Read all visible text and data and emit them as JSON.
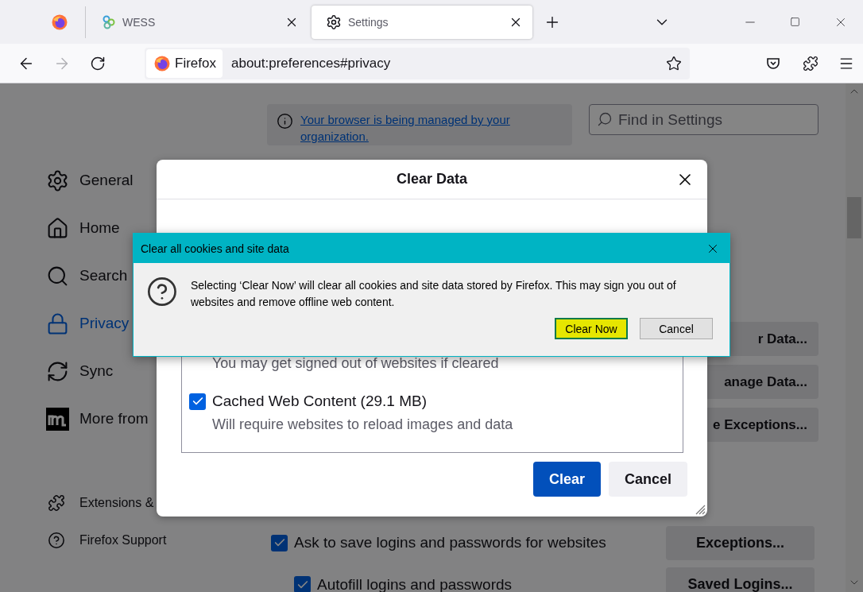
{
  "tab_strip": {
    "tabs": [
      {
        "title": "WESS",
        "selected": false
      },
      {
        "title": "Settings",
        "selected": true
      }
    ]
  },
  "nav_bar": {
    "buttons": [
      {
        "kind": "back",
        "disabled": false
      },
      {
        "kind": "forward",
        "disabled": true
      },
      {
        "kind": "reload",
        "disabled": false
      }
    ],
    "identity": "Firefox",
    "url": "about:preferences#privacy"
  },
  "notice": {
    "link": "Your browser is being managed by your organization."
  },
  "search": {
    "placeholder": "Find in Settings"
  },
  "sidebar": {
    "categories": [
      {
        "label": "General",
        "selected": false
      },
      {
        "label": "Home",
        "selected": false
      },
      {
        "label": "Search",
        "selected": false
      },
      {
        "label": "Privacy",
        "selected": true
      },
      {
        "label": "Sync",
        "selected": false
      },
      {
        "label": "More from",
        "selected": false
      }
    ],
    "footer": [
      {
        "label": "Extensions &"
      },
      {
        "label": "Firefox Support"
      }
    ]
  },
  "main": {
    "data_buttons": [
      "r Data...",
      "anage Data...",
      "e Exceptions..."
    ],
    "logins": [
      {
        "label": "Ask to save logins and passwords for websites",
        "checked": true,
        "kind": "main"
      },
      {
        "label": "Autofill logins and passwords",
        "checked": true,
        "kind": "sub"
      }
    ],
    "login_buttons": [
      "Exceptions...",
      "Saved Logins..."
    ]
  },
  "clear_data_dialog": {
    "title": "Clear Data",
    "items": [
      {
        "description": "You may get signed out of websites if cleared"
      },
      {
        "label": "Cached Web Content (29.1 MB)",
        "checked": true,
        "description": "Will require websites to reload images and data"
      }
    ],
    "buttons": [
      {
        "label": "Clear",
        "kind": "primary"
      },
      {
        "label": "Cancel",
        "kind": "secondary"
      }
    ]
  },
  "confirm_dialog": {
    "title": "Clear all cookies and site data",
    "message": "Selecting ‘Clear Now’ will clear all cookies and site data stored by Firefox. This may sign you out of websites and remove offline web content.",
    "buttons": [
      {
        "label": "Clear Now",
        "focused": true
      },
      {
        "label": "Cancel",
        "focused": false
      }
    ]
  }
}
